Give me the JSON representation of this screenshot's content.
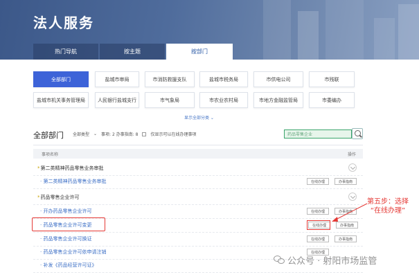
{
  "header": {
    "title": "法人服务"
  },
  "tabs": [
    {
      "label": "热门导航"
    },
    {
      "label": "按主题"
    },
    {
      "label": "按部门"
    }
  ],
  "departments": {
    "row1": [
      "全部部门",
      "盐城市审局",
      "市消防救援支队",
      "盐城市税务局",
      "市供电公司",
      "市残联"
    ],
    "row2": [
      "盐城市机关事务管理局",
      "人民银行盐城支行",
      "市气象局",
      "市农业农村局",
      "市地方金融监管局",
      "市委编办"
    ],
    "expand_label": "显示全部分类 ⌄"
  },
  "list": {
    "title": "全部部门",
    "filter_type": "全部类型",
    "filter_count": "事项: 2  办事指南: 8",
    "checkbox_label": "仅显示可以在线办理事项",
    "search_placeholder": "药品零售企业",
    "col_name": "事项名称",
    "col_op": "操作"
  },
  "rows": {
    "g1": "第二类精神药品零售业务审批",
    "i1": "第二类精神药品零售业务审批",
    "g2": "药品零售企业许可",
    "i2": "开办药品零售企业许可",
    "i3": "药品零售企业许可变更",
    "i4": "药品零售企业许可换证",
    "i5": "药品零售企业许可依申请注销",
    "i6": "补发《药品经营许可证》"
  },
  "buttons": {
    "online": "在线办理",
    "guide": "办事指南"
  },
  "annotation": {
    "line1": "第五步：选择",
    "line2": "“在线办理”"
  },
  "watermark": "公众号 · 射阳市场监管",
  "colors": {
    "accent": "#3d63d8",
    "annotation": "#e53935"
  }
}
